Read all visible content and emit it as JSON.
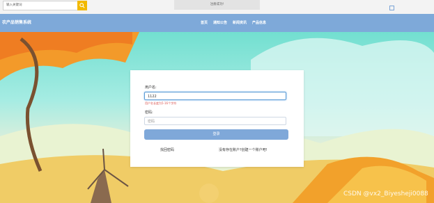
{
  "search": {
    "placeholder": "输入关键词"
  },
  "top_notice": "注册成功!",
  "brand": "农产品销售系统",
  "nav": [
    "首页",
    "通知公告",
    "新闻资讯",
    "产品信息"
  ],
  "form": {
    "username_label": "用户名:",
    "username_value": "1122",
    "username_error": "用户名长度为5-16个字符",
    "password_label": "密码:",
    "password_placeholder": "密码",
    "login_label": "登录",
    "forgot_label": "找回密码",
    "register_label": "没有存在账户?创建一个账户吧!"
  },
  "watermark": "CSDN @vx2_Biyesheji0088",
  "colors": {
    "nav": "#7ea9d9",
    "accent": "#f2b900",
    "error": "#d9534f",
    "button": "#7fa8d9"
  }
}
